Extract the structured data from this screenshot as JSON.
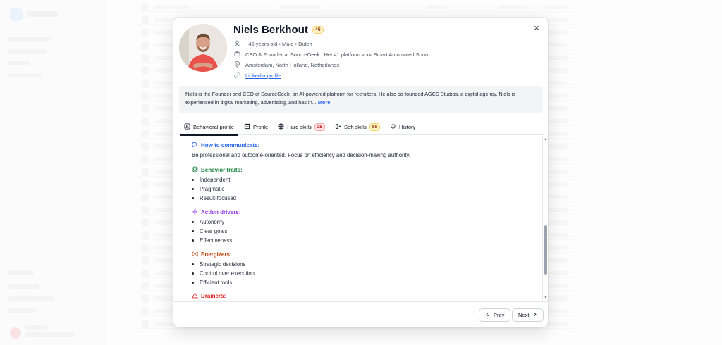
{
  "modal": {
    "close_label": "×",
    "name": "Niels Berkhout",
    "score": "46",
    "demographics": "~45 years old • Male • Dutch",
    "headline": "CEO & Founder at SourceGeek | Het #1 platform voor Smart Automated Sourc...",
    "location": "Amsterdam, North Holland, Netherlands",
    "linkedin_label": "LinkedIn profile",
    "summary": "Niels is the Founder and CEO of SourceGeek, an AI-powered platform for recruiters. He also co-founded AGCS Studios, a digital agency. Niels is experienced in digital marketing, advertising, and has in...",
    "more_label": "More"
  },
  "tabs": [
    {
      "label": "Behavioral profile",
      "icon": "id-card-icon",
      "active": true
    },
    {
      "label": "Profile",
      "icon": "table-icon"
    },
    {
      "label": "Hard skills",
      "icon": "globe-icon",
      "badge": "25"
    },
    {
      "label": "Soft skills",
      "icon": "brain-icon",
      "badge": "68"
    },
    {
      "label": "History",
      "icon": "history-icon"
    }
  ],
  "behavioral": {
    "communicate_title": "How to communicate:",
    "communicate_text": "Be professional and outcome-oriented. Focus on efficiency and decision-making authority.",
    "traits_title": "Behavior traits:",
    "traits": [
      "Independent",
      "Pragmatic",
      "Result-focused"
    ],
    "drivers_title": "Action drivers:",
    "drivers": [
      "Autonomy",
      "Clear goals",
      "Effectiveness"
    ],
    "energizers_title": "Energizers:",
    "energizers": [
      "Strategic decisions",
      "Control over execution",
      "Efficient tools"
    ],
    "drainers_title": "Drainers:"
  },
  "footer": {
    "prev_label": "Prev",
    "next_label": "Next"
  },
  "colors": {
    "communicate": "#2563eb",
    "traits": "#15803d",
    "drivers": "#9333ea",
    "energizers": "#c2410c",
    "drainers": "#dc2626"
  }
}
